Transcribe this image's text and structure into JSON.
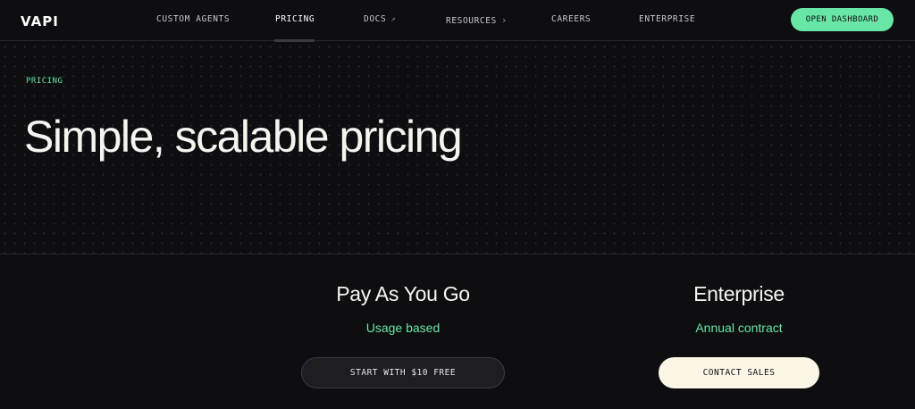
{
  "nav": {
    "logo": "VAPI",
    "links": [
      {
        "label": "CUSTOM AGENTS"
      },
      {
        "label": "PRICING"
      },
      {
        "label": "DOCS",
        "icon": "↗"
      },
      {
        "label": "RESOURCES",
        "icon": "›"
      },
      {
        "label": "CAREERS"
      },
      {
        "label": "ENTERPRISE"
      }
    ],
    "active": "PRICING",
    "cta_label": "OPEN DASHBOARD"
  },
  "hero": {
    "eyebrow": "PRICING",
    "headline": "Simple, scalable pricing"
  },
  "plans": [
    {
      "title": "Pay As You Go",
      "subtitle": "Usage based",
      "button": "START WITH $10 FREE"
    },
    {
      "title": "Enterprise",
      "subtitle": "Annual contract",
      "button": "CONTACT SALES"
    }
  ],
  "colors": {
    "background": "#0e0e11",
    "accent": "#68e6a5",
    "cta_light": "#fbf6e6"
  },
  "icons": {
    "docs": "external-link-icon",
    "resources": "chevron-right-icon"
  }
}
